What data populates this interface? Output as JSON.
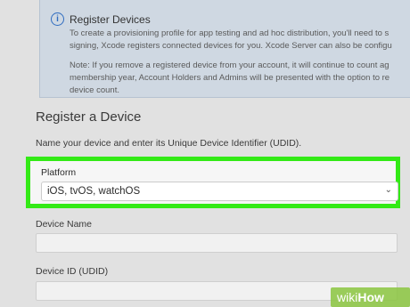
{
  "notice": {
    "icon": "info-icon",
    "title": "Register Devices",
    "body_lines": [
      "To create a provisioning profile for app testing and ad hoc distribution, you'll need to s",
      "signing, Xcode registers connected devices for you. Xcode Server can also be configu"
    ],
    "note_lines": [
      "Note: If you remove a registered device from your account, it will continue to count ag",
      "membership year, Account Holders and Admins will be presented with the option to re",
      "device count."
    ]
  },
  "form": {
    "title": "Register a Device",
    "subtitle": "Name your device and enter its Unique Device Identifier (UDID).",
    "platform": {
      "label": "Platform",
      "selected": "iOS, tvOS, watchOS",
      "chevron": "chevron-down-icon"
    },
    "device_name": {
      "label": "Device Name",
      "value": ""
    },
    "device_id": {
      "label": "Device ID (UDID)",
      "value": ""
    }
  },
  "colors": {
    "highlight": "#33ea16",
    "info_accent": "#2f6cc0",
    "watermark_green": "#8bc53f"
  },
  "watermark": {
    "text_wiki": "wiki",
    "text_how": "How"
  }
}
